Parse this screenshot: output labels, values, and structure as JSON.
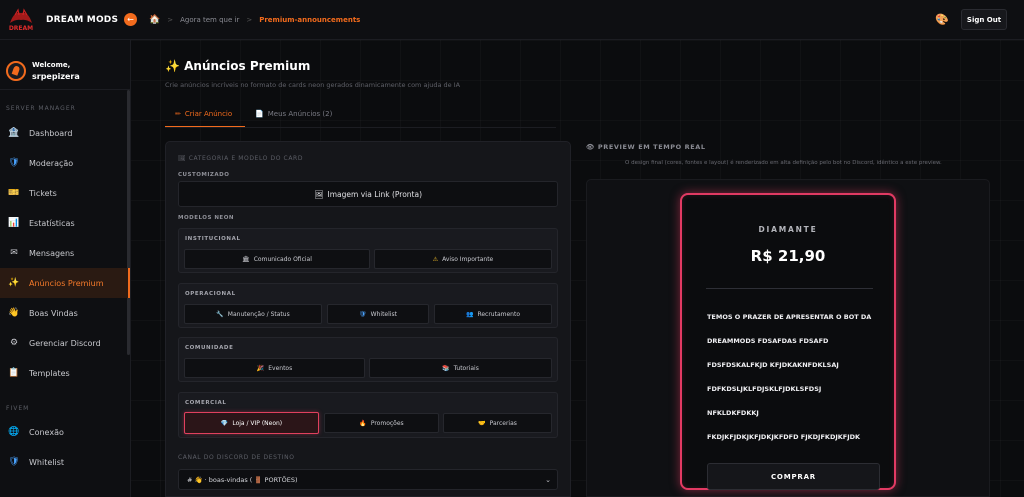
{
  "topbar": {
    "brand": "DREAM MODS",
    "logo_text": "DREAM",
    "breadcrumb": [
      "Agora tem que ir",
      "Premium-announcements"
    ],
    "sign_out": "Sign Out"
  },
  "sidebar": {
    "welcome": "Welcome,",
    "username": "srpepizera",
    "section_server": "SERVER MANAGER",
    "items": [
      {
        "label": "Dashboard",
        "icon": "bank-icon",
        "glyph": "🏦"
      },
      {
        "label": "Moderação",
        "icon": "shield-icon",
        "glyph": "🛡"
      },
      {
        "label": "Tickets",
        "icon": "ticket-icon",
        "glyph": "🎫"
      },
      {
        "label": "Estatísticas",
        "icon": "chart-icon",
        "glyph": "📊"
      },
      {
        "label": "Mensagens",
        "icon": "envelope-icon",
        "glyph": "✉"
      },
      {
        "label": "Anúncios Premium",
        "icon": "sparkles-icon",
        "glyph": "✨"
      },
      {
        "label": "Boas Vindas",
        "icon": "wave-icon",
        "glyph": "👋"
      },
      {
        "label": "Gerenciar Discord",
        "icon": "gear-icon",
        "glyph": "⚙"
      },
      {
        "label": "Templates",
        "icon": "clipboard-icon",
        "glyph": "📋"
      }
    ],
    "section_fivem": "FIVEM",
    "fivem_items": [
      {
        "label": "Conexão",
        "icon": "globe-icon",
        "glyph": "🌐"
      },
      {
        "label": "Whitelist",
        "icon": "shield-icon",
        "glyph": "🛡"
      }
    ]
  },
  "main": {
    "title": "✨ Anúncios Premium",
    "subtitle": "Crie anúncios incríveis no formato de cards neon gerados dinamicamente com ajuda de IA",
    "tabs": [
      "Criar Anúncio",
      "Meus Anúncios (2)"
    ],
    "form": {
      "category_label": "CATEGORIA E MODELO DO CARD",
      "custom_label": "CUSTOMIZADO",
      "custom_button": "Imagem via Link (Pronta)",
      "neon_label": "MODELOS NEON",
      "groups": [
        {
          "title": "INSTITUCIONAL",
          "buttons": [
            {
              "label": "Comunicado Oficial",
              "glyph": "🏛"
            },
            {
              "label": "Aviso Importante",
              "glyph": "⚠"
            }
          ]
        },
        {
          "title": "OPERACIONAL",
          "buttons": [
            {
              "label": "Manutenção / Status",
              "glyph": "🔧"
            },
            {
              "label": "Whitelist",
              "glyph": "🛡"
            },
            {
              "label": "Recrutamento",
              "glyph": "👥"
            }
          ]
        },
        {
          "title": "COMUNIDADE",
          "buttons": [
            {
              "label": "Eventos",
              "glyph": "🎉"
            },
            {
              "label": "Tutoriais",
              "glyph": "📚"
            }
          ]
        },
        {
          "title": "COMERCIAL",
          "buttons": [
            {
              "label": "Loja / VIP (Neon)",
              "glyph": "💎"
            },
            {
              "label": "Promoções",
              "glyph": "🔥"
            },
            {
              "label": "Parcerias",
              "glyph": "🤝"
            }
          ]
        }
      ],
      "channel_label": "CANAL DO DISCORD DE DESTINO",
      "channel_value": "# 👋 · boas-vindas ( 🚪 PORTÕES)"
    },
    "preview": {
      "title": "PREVIEW EM TEMPO REAL",
      "subtitle": "O design final (cores, fontes e layout) é renderizado em alta definição pelo bot no Discord, idêntico a este preview.",
      "card": {
        "tier": "DIAMANTE",
        "price": "R$ 21,90",
        "lines": [
          "TEMOS O PRAZER DE APRESENTAR O BOT DA",
          "DREAMMODS FDSAFDAS FDSAFD",
          "FDSFDSKALFKJD KFJDKAKNFDKLSAJ",
          "FDFKDSLJKLFDJSKLFJDKLSFDSJ",
          "NFKLDKFDKKJ",
          "FKDJKFJDKJKFJDKJKFDFD FJKDJFKDJKFJDK"
        ],
        "button": "COMPRAR"
      }
    }
  },
  "colors": {
    "accent": "#f26b1d",
    "neon": "#e23a63"
  }
}
